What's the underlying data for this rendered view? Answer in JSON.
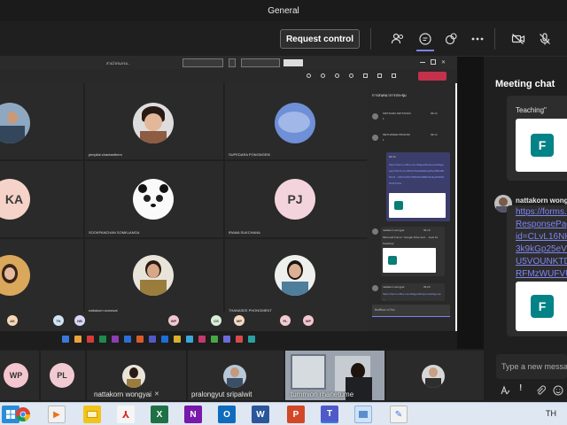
{
  "window": {
    "title": "General"
  },
  "toolbar": {
    "request_control_label": "Request control"
  },
  "shared_screen": {
    "inner_title": "การประชุมออนไลน์",
    "tiles": [
      {
        "name": "pimpilai chantanthem"
      },
      {
        "name": "SUPEDARA PONGNGEIK"
      },
      {
        "name": "SOOKPANCHAN SOMKLANGA"
      },
      {
        "name": "IRAMA SUKCHANA",
        "initials": "PJ"
      },
      {
        "name": "nattakorn wongyai"
      },
      {
        "name": "THANASEE PHONGMENT"
      }
    ],
    "left_initials": "KA",
    "strip_initials": [
      "AK",
      "TK",
      "NB",
      "WP",
      "CS",
      "MP",
      "PL",
      "WP"
    ],
    "inner_chat": {
      "title": "การสนทนาการประชุม",
      "messages": [
        {
          "name": "KRITSADA JIETTANAN",
          "time": "09.14",
          "text": "1"
        },
        {
          "name": "METHAWEE PRAKAM",
          "time": "09.14",
          "text": "1"
        },
        {
          "name": "",
          "time": "09.16",
          "link": "https://forms.office.com/Pages/ResponsePage.aspx?id=CLvL16NH7X0ak3k9kGp25eVBKw8K5Gv5...U5VOUNKTDRMSVNBR2NnIkpFRFMzWUFVU4u"
        },
        {
          "name": "nattakorn wongyai",
          "time": "09.19",
          "text": "Microsoft Forms: \"Google Drive and ... tools for Teaching\""
        },
        {
          "name": "nattakorn wongyai",
          "time": "09.24",
          "link": "https://forms.office.com/Pages/ResponsePage.aspx"
        }
      ],
      "compose_placeholder": "พิมพ์ข้อความใหม่"
    }
  },
  "meeting_chat": {
    "title": "Meeting chat",
    "prev_card_text": "Teaching\"",
    "sender": "nattakorn wongyai",
    "link_lines": [
      "https://forms.",
      "ResponsePage",
      "id=CLvL16NH",
      "3k9kGp25eVBK",
      "U5VOUNKTDR",
      "RFMzWUFVU4"
    ],
    "compose_placeholder": "Type a new message"
  },
  "bottom_participants": [
    {
      "initials": "WP"
    },
    {
      "initials": "PL"
    },
    {
      "name": "nattakorn wongyai"
    },
    {
      "name": "pralongyut sripalwit"
    },
    {
      "name": "tummion rhanetume"
    }
  ],
  "taskbar": {
    "language": "TH"
  },
  "colors": {
    "accent": "#7b83eb",
    "teams_bg": "#1f1f1f",
    "forms_green": "#038387",
    "link": "#7f85f5"
  }
}
